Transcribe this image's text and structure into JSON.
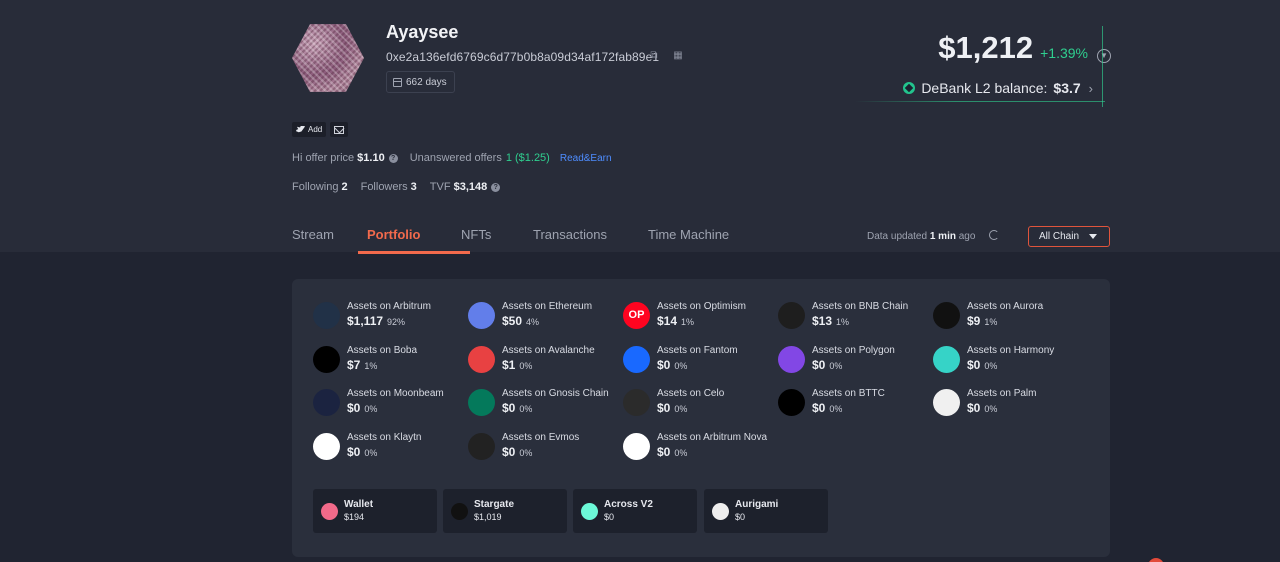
{
  "profile": {
    "name": "Ayaysee",
    "address": "0xe2a136efd6769c6d77b0b8a09d34af172fab89e1",
    "days": "662 days",
    "twitter_label": "Add"
  },
  "balance": {
    "total": "$1,212",
    "change": "+1.39%",
    "l2_label": "DeBank L2 balance:",
    "l2_value": "$3.7"
  },
  "stats": {
    "offer_label": "Hi offer price",
    "offer_value": "$1.10",
    "unanswered_label": "Unanswered offers",
    "unanswered_value": "1 ($1.25)",
    "read_earn": "Read&Earn",
    "following_label": "Following",
    "following_value": "2",
    "followers_label": "Followers",
    "followers_value": "3",
    "tvf_label": "TVF",
    "tvf_value": "$3,148"
  },
  "tabs": [
    "Stream",
    "Portfolio",
    "NFTs",
    "Transactions",
    "Time Machine"
  ],
  "active_tab": "Portfolio",
  "updated": {
    "prefix": "Data updated",
    "time": "1 min",
    "suffix": "ago"
  },
  "chain_filter": "All Chain",
  "chains": [
    {
      "name": "Assets on Arbitrum",
      "value": "$1,117",
      "pct": "92%",
      "icon": "arbitrum-icon",
      "color": "#213147"
    },
    {
      "name": "Assets on Ethereum",
      "value": "$50",
      "pct": "4%",
      "icon": "ethereum-icon",
      "color": "#627eea"
    },
    {
      "name": "Assets on Optimism",
      "value": "$14",
      "pct": "1%",
      "icon": "optimism-icon",
      "color": "#ff0420",
      "glyph": "OP"
    },
    {
      "name": "Assets on BNB Chain",
      "value": "$13",
      "pct": "1%",
      "icon": "bnb-icon",
      "color": "#1e1e1e"
    },
    {
      "name": "Assets on Aurora",
      "value": "$9",
      "pct": "1%",
      "icon": "aurora-icon",
      "color": "#111"
    },
    {
      "name": "Assets on Boba",
      "value": "$7",
      "pct": "1%",
      "icon": "boba-icon",
      "color": "#000"
    },
    {
      "name": "Assets on Avalanche",
      "value": "$1",
      "pct": "0%",
      "icon": "avalanche-icon",
      "color": "#e84142"
    },
    {
      "name": "Assets on Fantom",
      "value": "$0",
      "pct": "0%",
      "icon": "fantom-icon",
      "color": "#1969ff"
    },
    {
      "name": "Assets on Polygon",
      "value": "$0",
      "pct": "0%",
      "icon": "polygon-icon",
      "color": "#8247e5"
    },
    {
      "name": "Assets on Harmony",
      "value": "$0",
      "pct": "0%",
      "icon": "harmony-icon",
      "color": "#36d3c7"
    },
    {
      "name": "Assets on Moonbeam",
      "value": "$0",
      "pct": "0%",
      "icon": "moonbeam-icon",
      "color": "#1b2340"
    },
    {
      "name": "Assets on Gnosis Chain",
      "value": "$0",
      "pct": "0%",
      "icon": "gnosis-icon",
      "color": "#04795b"
    },
    {
      "name": "Assets on Celo",
      "value": "$0",
      "pct": "0%",
      "icon": "celo-icon",
      "color": "#2b2b2b"
    },
    {
      "name": "Assets on BTTC",
      "value": "$0",
      "pct": "0%",
      "icon": "bttc-icon",
      "color": "#000"
    },
    {
      "name": "Assets on Palm",
      "value": "$0",
      "pct": "0%",
      "icon": "palm-icon",
      "color": "#f0f0f0"
    },
    {
      "name": "Assets on Klaytn",
      "value": "$0",
      "pct": "0%",
      "icon": "klaytn-icon",
      "color": "#fff"
    },
    {
      "name": "Assets on Evmos",
      "value": "$0",
      "pct": "0%",
      "icon": "evmos-icon",
      "color": "#222"
    },
    {
      "name": "Assets on Arbitrum Nova",
      "value": "$0",
      "pct": "0%",
      "icon": "arbitrum-nova-icon",
      "color": "#fff"
    }
  ],
  "protocols": [
    {
      "name": "Wallet",
      "value": "$194",
      "icon": "wallet-icon",
      "color": "#f26a8a"
    },
    {
      "name": "Stargate",
      "value": "$1,019",
      "icon": "stargate-icon",
      "color": "#111"
    },
    {
      "name": "Across V2",
      "value": "$0",
      "icon": "across-icon",
      "color": "#6cf9d8"
    },
    {
      "name": "Aurigami",
      "value": "$0",
      "icon": "aurigami-icon",
      "color": "#eee"
    }
  ]
}
